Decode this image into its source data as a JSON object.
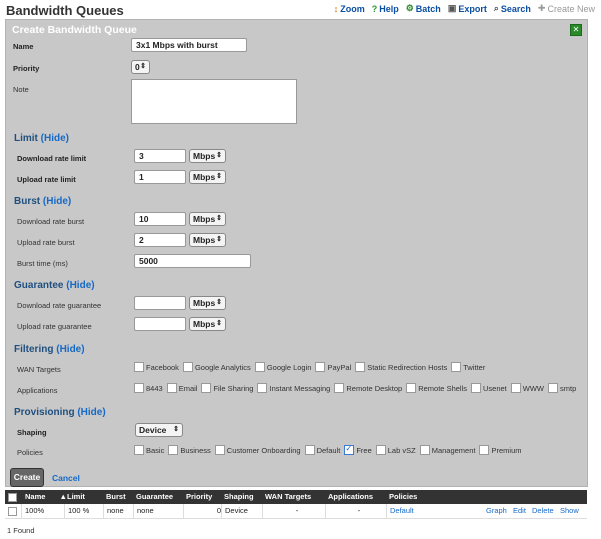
{
  "app": {
    "title": "Bandwidth Queues",
    "toolbar": [
      {
        "label": "Zoom",
        "icon": "zoom-icon",
        "glyph": "↕"
      },
      {
        "label": "Help",
        "icon": "help-icon",
        "glyph": "?"
      },
      {
        "label": "Batch",
        "icon": "batch-icon",
        "glyph": "⚙"
      },
      {
        "label": "Export",
        "icon": "export-icon",
        "glyph": "▣"
      },
      {
        "label": "Search",
        "icon": "search-icon",
        "glyph": "⌕"
      },
      {
        "label": "Create New",
        "icon": "create-new-icon",
        "glyph": "✚"
      }
    ]
  },
  "form": {
    "title": "Create Bandwidth Queue",
    "close_glyph": "✕",
    "name_label": "Name",
    "name_value": "3x1 Mbps with burst",
    "priority_label": "Priority",
    "priority_value": "0",
    "note_label": "Note",
    "note_value": "",
    "limit": {
      "title": "Limit",
      "hide": "(Hide)",
      "download_label": "Download rate limit",
      "download_value": "3",
      "download_unit": "Mbps",
      "upload_label": "Upload rate limit",
      "upload_value": "1",
      "upload_unit": "Mbps"
    },
    "burst": {
      "title": "Burst",
      "hide": "(Hide)",
      "download_label": "Download rate burst",
      "download_value": "10",
      "download_unit": "Mbps",
      "upload_label": "Upload rate burst",
      "upload_value": "2",
      "upload_unit": "Mbps",
      "time_label": "Burst time (ms)",
      "time_value": "5000"
    },
    "guarantee": {
      "title": "Guarantee",
      "hide": "(Hide)",
      "download_label": "Download rate guarantee",
      "download_value": "",
      "download_unit": "Mbps",
      "upload_label": "Upload rate guarantee",
      "upload_value": "",
      "upload_unit": "Mbps"
    },
    "filtering": {
      "title": "Filtering",
      "hide": "(Hide)",
      "wan_label": "WAN Targets",
      "wan_options": [
        "Facebook",
        "Google Analytics",
        "Google Login",
        "PayPal",
        "Static Redirection Hosts",
        "Twitter"
      ],
      "apps_label": "Applications",
      "apps_options": [
        "8443",
        "Email",
        "File Sharing",
        "Instant Messaging",
        "Remote Desktop",
        "Remote Shells",
        "Usenet",
        "WWW",
        "smtp"
      ]
    },
    "provisioning": {
      "title": "Provisioning",
      "hide": "(Hide)",
      "shaping_label": "Shaping",
      "shaping_value": "Device",
      "policies_label": "Policies",
      "policies_options": [
        {
          "label": "Basic",
          "checked": false
        },
        {
          "label": "Business",
          "checked": false
        },
        {
          "label": "Customer Onboarding",
          "checked": false
        },
        {
          "label": "Default",
          "checked": false
        },
        {
          "label": "Free",
          "checked": true
        },
        {
          "label": "Lab vSZ",
          "checked": false
        },
        {
          "label": "Management",
          "checked": false
        },
        {
          "label": "Premium",
          "checked": false
        }
      ]
    },
    "create_label": "Create",
    "cancel_label": "Cancel"
  },
  "table": {
    "columns": [
      "Name",
      "Limit",
      "Burst",
      "Guarantee",
      "Priority",
      "Shaping",
      "WAN Targets",
      "Applications",
      "Policies"
    ],
    "sort_indicator": "▲",
    "rows": [
      {
        "name": "100%",
        "limit": "100 %",
        "burst": "none",
        "guarantee": "none",
        "priority": "0",
        "shaping": "Device",
        "wan": "-",
        "apps": "-",
        "policies": "Default",
        "actions": [
          "Graph",
          "Edit",
          "Delete",
          "Show"
        ]
      }
    ],
    "found": "1 Found"
  },
  "colors": {
    "accent": "#1569c7",
    "panel": "#c8c8c8",
    "header": "#333333",
    "checked": "#1a5bb5"
  }
}
